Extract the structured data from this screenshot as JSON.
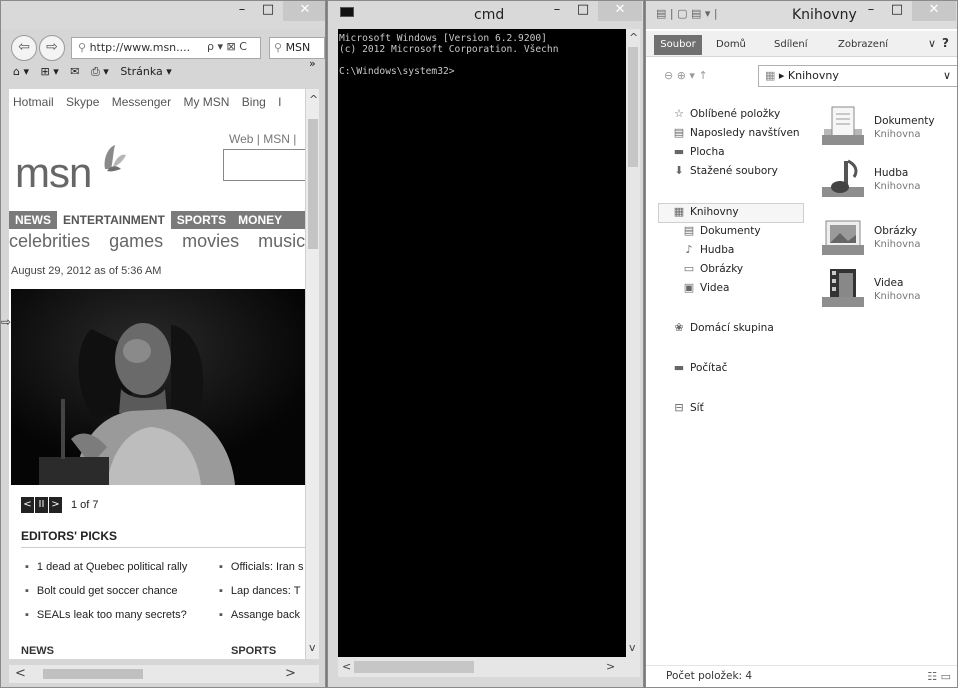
{
  "ie": {
    "window_controls": {
      "min": "–",
      "max": "□",
      "close": "✕"
    },
    "back": "⇦",
    "forward": "⇨",
    "address": "http://www.msn....",
    "address_bold": "",
    "address_icons": "ρ ▾ ⊠ C",
    "tab_label": "MSN",
    "overflow_chevron": "»",
    "commandbar": {
      "home": "⌂ ▾",
      "feeds": "⊞ ▾",
      "mail": "✉",
      "print": "⎙ ▾",
      "page": "Stránka ▾"
    },
    "msn_links": [
      "Hotmail",
      "Skype",
      "Messenger",
      "My MSN",
      "Bing",
      "I"
    ],
    "search_scope": "Web  |  MSN  |",
    "logo": "msn",
    "categories": [
      "NEWS",
      "ENTERTAINMENT",
      "SPORTS",
      "MONEY"
    ],
    "active_category": "ENTERTAINMENT",
    "subcategories": [
      "celebrities",
      "games",
      "movies",
      "music"
    ],
    "dateline": "August 29, 2012 as of 5:36 AM",
    "pager": {
      "prev": "<",
      "pause": "II",
      "next": ">",
      "count": "1 of 7"
    },
    "editors_title": "EDITORS' PICKS",
    "editors_left": [
      "1 dead at Quebec political rally",
      "Bolt could get soccer chance",
      "SEALs leak too many secrets?"
    ],
    "editors_right": [
      "Officials: Iran s",
      "Lap dances: T",
      "Assange back"
    ],
    "footer_left": "NEWS",
    "footer_right": "SPORTS",
    "hscroll_left": "<",
    "hscroll_right": ">",
    "vscroll_up": "^",
    "vscroll_down": "v",
    "side_arrow": "⇨"
  },
  "cmd": {
    "title": "cmd",
    "window_controls": {
      "min": "–",
      "max": "□",
      "close": "✕"
    },
    "lines": [
      "Microsoft Windows [Version 6.2.9200]",
      "(c) 2012 Microsoft Corporation. Všechn",
      "",
      "C:\\Windows\\system32>"
    ],
    "scroll_up": "^",
    "scroll_down": "v",
    "scroll_left": "<",
    "scroll_right": ">"
  },
  "explorer": {
    "title": "Knihovny",
    "window_controls": {
      "min": "–",
      "max": "□",
      "close": "✕"
    },
    "ribbon_tabs": [
      "Soubor",
      "Domů",
      "Sdílení",
      "Zobrazení"
    ],
    "help": "?",
    "path_nav": "⊖  ⊕  ▾  ↑",
    "path": "▸ Knihovny",
    "path_dropdown": "∨",
    "tree": [
      {
        "label": "Oblíbené položky",
        "icon": "star-icon",
        "glyph": "☆"
      },
      {
        "label": "Naposledy navštíven",
        "icon": "recent-places-icon",
        "glyph": "▤"
      },
      {
        "label": "Plocha",
        "icon": "desktop-icon",
        "glyph": "▬"
      },
      {
        "label": "Stažené soubory",
        "icon": "downloads-icon",
        "glyph": "⬇"
      },
      {
        "label": "Knihovny",
        "icon": "libraries-icon",
        "glyph": "▦"
      },
      {
        "label": "Dokumenty",
        "icon": "documents-icon",
        "glyph": "▤"
      },
      {
        "label": "Hudba",
        "icon": "music-icon",
        "glyph": "♪"
      },
      {
        "label": "Obrázky",
        "icon": "pictures-icon",
        "glyph": "▭"
      },
      {
        "label": "Videa",
        "icon": "videos-icon",
        "glyph": "▣"
      },
      {
        "label": "Domácí skupina",
        "icon": "homegroup-icon",
        "glyph": "❀"
      },
      {
        "label": "Počítač",
        "icon": "computer-icon",
        "glyph": "▬"
      },
      {
        "label": "Síť",
        "icon": "network-icon",
        "glyph": "⊟"
      }
    ],
    "libraries": [
      {
        "name": "Dokumenty",
        "sub": "Knihovna",
        "icon": "documents-library-icon"
      },
      {
        "name": "Hudba",
        "sub": "Knihovna",
        "icon": "music-library-icon"
      },
      {
        "name": "Obrázky",
        "sub": "Knihovna",
        "icon": "pictures-library-icon"
      },
      {
        "name": "Videa",
        "sub": "Knihovna",
        "icon": "videos-library-icon"
      }
    ],
    "status": "Počet položek: 4",
    "view_icons": "☷ ▭"
  }
}
